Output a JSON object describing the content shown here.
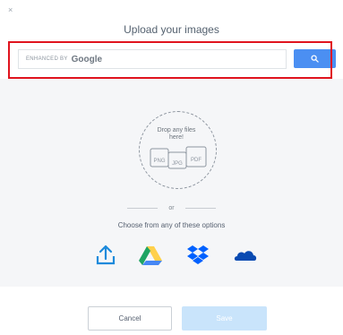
{
  "dialog": {
    "corner_mark": "×",
    "title": "Upload your images"
  },
  "search": {
    "enhanced_by": "ENHANCED BY",
    "brand": "Google",
    "button_icon": "search-icon"
  },
  "dropzone": {
    "text_line1": "Drop any files",
    "text_line2": "here!",
    "file_types": [
      "PNG",
      "JPG",
      "PDF"
    ]
  },
  "divider": {
    "or_label": "or"
  },
  "options": {
    "heading": "Choose from any of these options",
    "sources": [
      "upload-icon",
      "google-drive-icon",
      "dropbox-icon",
      "onedrive-icon"
    ]
  },
  "footer": {
    "cancel_label": "Cancel",
    "save_label": "Save"
  },
  "colors": {
    "accent": "#4b8ff2",
    "highlight": "#e0141e",
    "save_disabled": "#c9e4fb",
    "upload": "#1c8adb",
    "drive_green": "#1fa463",
    "drive_yellow": "#ffd04b",
    "drive_blue": "#4687f4",
    "dropbox": "#0061ff",
    "onedrive": "#094ab2"
  }
}
